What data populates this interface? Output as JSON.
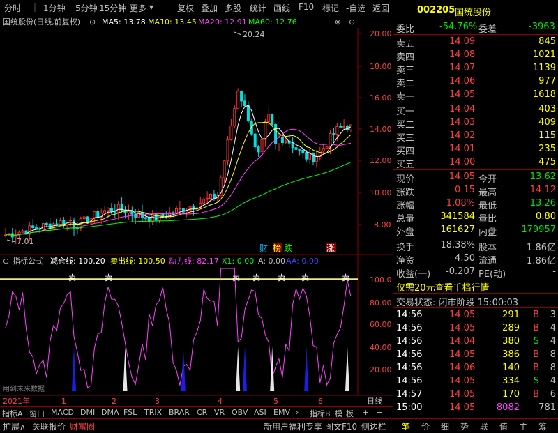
{
  "toolbar": {
    "left": [
      "分时",
      "1分钟",
      "5分钟",
      "15分钟",
      "更多"
    ],
    "right": [
      "复权",
      "叠加",
      "多股",
      "统计",
      "画线",
      "F10",
      "标记",
      "-自选",
      "返回"
    ]
  },
  "chart": {
    "stock_title": "国统股份(日线,前复权)",
    "ma5": "MA5: 13.78",
    "ma10": "MA10: 13.45",
    "ma20": "MA20: 12.91",
    "ma60": "MA60: 12.76",
    "price_axis": [
      "20.00",
      "18.00",
      "16.00",
      "14.00",
      "12.00",
      "10.00",
      "8.00"
    ],
    "high_label": "20.24",
    "low_label": "7.01",
    "markers": {
      "cai": "财",
      "bang": "榜",
      "die": "跌",
      "zhang": "涨"
    }
  },
  "indicator": {
    "name": "指标公式",
    "reduce_label": "减仓线: 100.20",
    "sell_label": "卖出线: 100.50",
    "power_label": "动力线: 82.17",
    "x1_label": "X1: 0.00",
    "a_label": "A: 0.00",
    "aa_label": "AA: 0.00",
    "axis": [
      "100.0",
      "80.00",
      "60.00",
      "40.00",
      "20.00"
    ],
    "sell_marks": [
      "卖",
      "卖",
      "卖",
      "卖",
      "卖",
      "卖",
      "卖"
    ],
    "future_note": "用到未来数据"
  },
  "timeaxis": {
    "year": "2021年",
    "months": [
      "1",
      "2",
      "3",
      "4",
      "5",
      "6"
    ],
    "period": "日线"
  },
  "indicator_tabs": [
    "指标A",
    "窗口",
    "MACD",
    "DMI",
    "DMA",
    "FSL",
    "TRIX",
    "BRAR",
    "CR",
    "VR",
    "OBV",
    "ASI",
    "EMV"
  ],
  "indicator_tabs_right": [
    "指标B",
    "模",
    "板"
  ],
  "status": {
    "left": [
      "扩展∧",
      "关联报价",
      "财富圈"
    ],
    "promo": "新用户福利专享",
    "right_items": [
      "图文F10",
      "侧边栏"
    ],
    "panel_tabs": [
      "笔",
      "价",
      "细",
      "势",
      "联",
      "值",
      "主",
      "筹"
    ]
  },
  "quote": {
    "code": "002205",
    "name": "国统股份",
    "webi_label": "委比",
    "webi": "-54.76%",
    "weicha_label": "委差",
    "weicha": "-3963",
    "asks": [
      {
        "label": "卖五",
        "price": "14.09",
        "vol": "845"
      },
      {
        "label": "卖四",
        "price": "14.08",
        "vol": "1021"
      },
      {
        "label": "卖三",
        "price": "14.07",
        "vol": "1139"
      },
      {
        "label": "卖二",
        "price": "14.06",
        "vol": "977"
      },
      {
        "label": "卖一",
        "price": "14.05",
        "vol": "1618"
      }
    ],
    "bids": [
      {
        "label": "买一",
        "price": "14.04",
        "vol": "403"
      },
      {
        "label": "买二",
        "price": "14.03",
        "vol": "409"
      },
      {
        "label": "买三",
        "price": "14.02",
        "vol": "115"
      },
      {
        "label": "买四",
        "price": "14.01",
        "vol": "235"
      },
      {
        "label": "买五",
        "price": "14.00",
        "vol": "475"
      }
    ],
    "stats": [
      {
        "l1": "现价",
        "v1": "14.05",
        "l2": "今开",
        "v2": "13.62"
      },
      {
        "l1": "涨跌",
        "v1": "0.15",
        "l2": "最高",
        "v2": "14.12"
      },
      {
        "l1": "涨幅",
        "v1": "1.08%",
        "l2": "最低",
        "v2": "13.26"
      },
      {
        "l1": "总量",
        "v1": "341584",
        "l2": "量比",
        "v2": "0.80"
      },
      {
        "l1": "外盘",
        "v1": "161627",
        "l2": "内盘",
        "v2": "179957"
      }
    ],
    "stats2": [
      {
        "l1": "换手",
        "v1": "18.38%",
        "l2": "股本",
        "v2": "1.86亿"
      },
      {
        "l1": "净资",
        "v1": "4.50",
        "l2": "流通",
        "v2": "1.86亿"
      },
      {
        "l1": "收益(一)",
        "v1": "-0.207",
        "l2": "PE(动)",
        "v2": "-"
      }
    ],
    "promo": "仅需20元查看千档行情",
    "trade_status": "交易状态: 闭市阶段 15:00:03",
    "ticks": [
      {
        "t": "14:56",
        "p": "14.05",
        "v": "291",
        "s": "B",
        "n": "3"
      },
      {
        "t": "14:56",
        "p": "14.05",
        "v": "289",
        "s": "B",
        "n": "4"
      },
      {
        "t": "14:56",
        "p": "14.04",
        "v": "380",
        "s": "S",
        "n": "4"
      },
      {
        "t": "14:56",
        "p": "14.05",
        "v": "386",
        "s": "B",
        "n": "8"
      },
      {
        "t": "14:56",
        "p": "14.06",
        "v": "140",
        "s": "B",
        "n": "8"
      },
      {
        "t": "14:56",
        "p": "14.05",
        "v": "334",
        "s": "S",
        "n": "4"
      },
      {
        "t": "14:57",
        "p": "14.05",
        "v": "170",
        "s": "B",
        "n": "6"
      },
      {
        "t": "15:00",
        "p": "14.05",
        "v": "8082",
        "s": "",
        "n": "781"
      }
    ]
  }
}
